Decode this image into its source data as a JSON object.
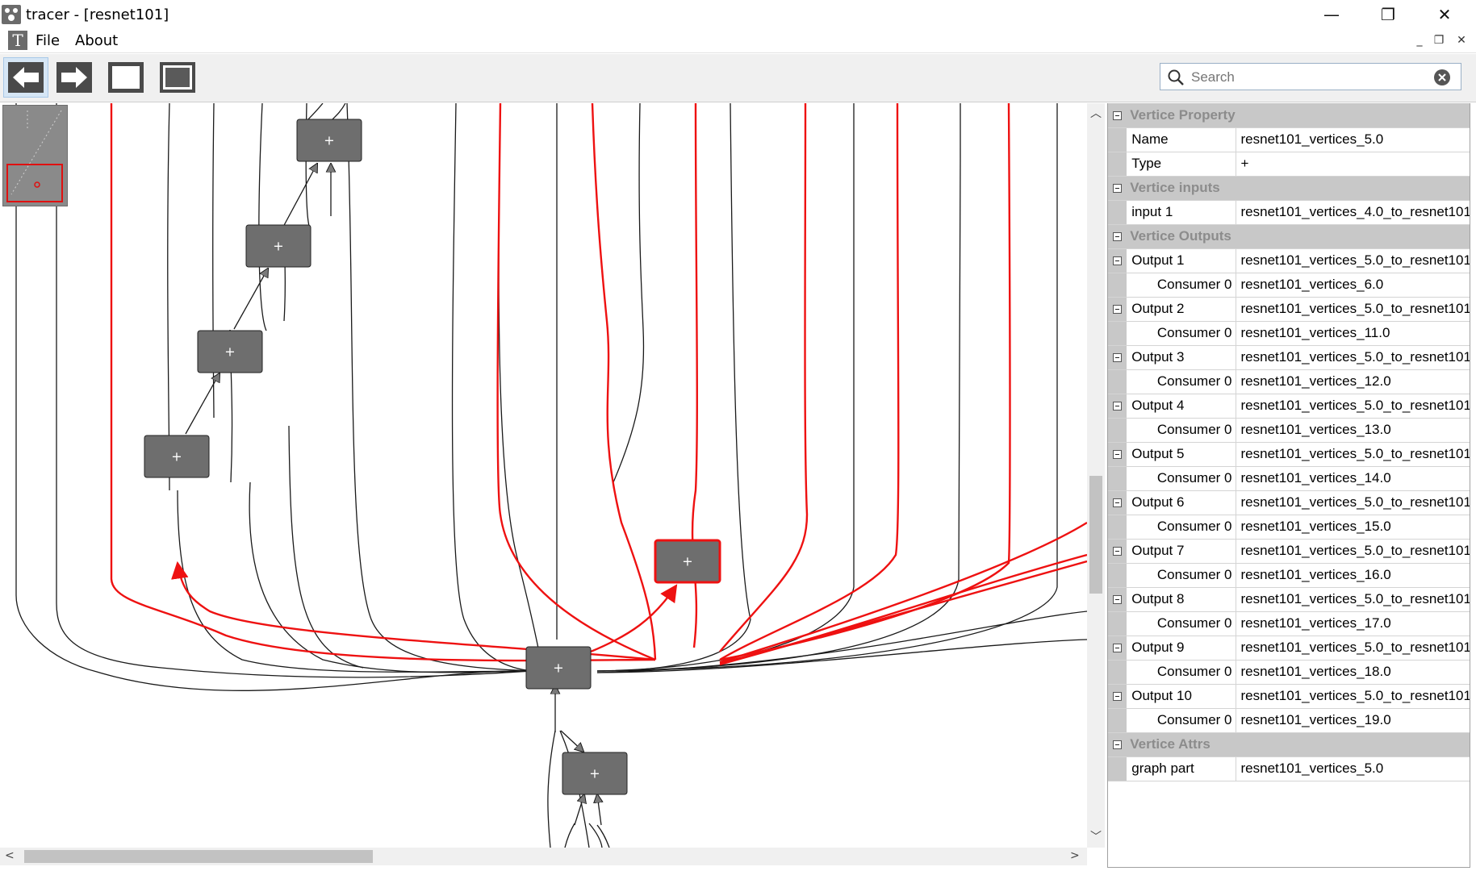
{
  "window": {
    "title": "tracer - [resnet101]",
    "minimize": "—",
    "maximize": "❐",
    "close": "✕"
  },
  "menu": {
    "logo": "T",
    "file": "File",
    "about": "About",
    "mdi_minimize": "_",
    "mdi_restore": "❐",
    "mdi_close": "✕"
  },
  "toolbar": {
    "back_icon": "arrow-left-icon",
    "forward_icon": "arrow-right-icon",
    "window1_icon": "window-outline-icon",
    "window2_icon": "window-filled-icon"
  },
  "search": {
    "placeholder": "Search",
    "value": ""
  },
  "graph": {
    "node_label": "+",
    "highlight_color": "#ee1111",
    "node_color": "#6e6e6e",
    "edge_color": "#1a1a1a"
  },
  "properties": {
    "sections": [
      {
        "title": "Vertice Property",
        "rows": [
          {
            "name": "Name",
            "value": "resnet101_vertices_5.0"
          },
          {
            "name": "Type",
            "value": "+"
          }
        ]
      },
      {
        "title": "Vertice inputs",
        "rows": [
          {
            "name": "input 1",
            "value": "resnet101_vertices_4.0_to_resnet101"
          }
        ]
      },
      {
        "title": "Vertice Outputs",
        "rows": [
          {
            "name": "Output 1",
            "value": "resnet101_vertices_5.0_to_resnet101",
            "consumer_label": "Consumer 0",
            "consumer": "resnet101_vertices_6.0"
          },
          {
            "name": "Output 2",
            "value": "resnet101_vertices_5.0_to_resnet101",
            "consumer_label": "Consumer 0",
            "consumer": "resnet101_vertices_11.0"
          },
          {
            "name": "Output 3",
            "value": "resnet101_vertices_5.0_to_resnet101",
            "consumer_label": "Consumer 0",
            "consumer": "resnet101_vertices_12.0"
          },
          {
            "name": "Output 4",
            "value": "resnet101_vertices_5.0_to_resnet101",
            "consumer_label": "Consumer 0",
            "consumer": "resnet101_vertices_13.0"
          },
          {
            "name": "Output 5",
            "value": "resnet101_vertices_5.0_to_resnet101",
            "consumer_label": "Consumer 0",
            "consumer": "resnet101_vertices_14.0"
          },
          {
            "name": "Output 6",
            "value": "resnet101_vertices_5.0_to_resnet101",
            "consumer_label": "Consumer 0",
            "consumer": "resnet101_vertices_15.0"
          },
          {
            "name": "Output 7",
            "value": "resnet101_vertices_5.0_to_resnet101",
            "consumer_label": "Consumer 0",
            "consumer": "resnet101_vertices_16.0"
          },
          {
            "name": "Output 8",
            "value": "resnet101_vertices_5.0_to_resnet101",
            "consumer_label": "Consumer 0",
            "consumer": "resnet101_vertices_17.0"
          },
          {
            "name": "Output 9",
            "value": "resnet101_vertices_5.0_to_resnet101",
            "consumer_label": "Consumer 0",
            "consumer": "resnet101_vertices_18.0"
          },
          {
            "name": "Output 10",
            "value": "resnet101_vertices_5.0_to_resnet101",
            "consumer_label": "Consumer 0",
            "consumer": "resnet101_vertices_19.0"
          }
        ]
      },
      {
        "title": "Vertice Attrs",
        "rows": [
          {
            "name": "graph part",
            "value": "resnet101_vertices_5.0"
          }
        ]
      }
    ]
  }
}
